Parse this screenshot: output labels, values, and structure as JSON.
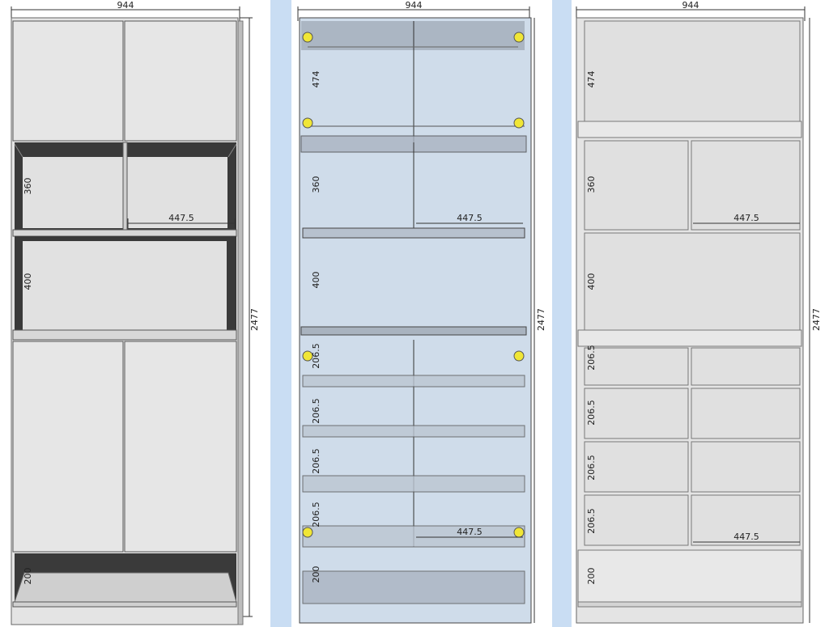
{
  "views": [
    {
      "id": "front-closed",
      "width_label": "944",
      "height_label": "2477",
      "dimensions": [
        {
          "key": "d1",
          "text": "360"
        },
        {
          "key": "d2",
          "text": "400"
        },
        {
          "key": "d3",
          "text": "200"
        },
        {
          "key": "d4",
          "text": "447.5"
        }
      ]
    },
    {
      "id": "transparent",
      "width_label": "944",
      "height_label": "2477",
      "dimensions": [
        {
          "key": "d1",
          "text": "474"
        },
        {
          "key": "d2",
          "text": "360"
        },
        {
          "key": "d3",
          "text": "400"
        },
        {
          "key": "d4",
          "text": "206.5"
        },
        {
          "key": "d5",
          "text": "206.5"
        },
        {
          "key": "d6",
          "text": "206.5"
        },
        {
          "key": "d7",
          "text": "206.5"
        },
        {
          "key": "d8",
          "text": "200"
        },
        {
          "key": "d9",
          "text": "447.5"
        },
        {
          "key": "d10",
          "text": "447.5"
        }
      ]
    },
    {
      "id": "open-front",
      "width_label": "944",
      "height_label": "2477",
      "dimensions": [
        {
          "key": "d1",
          "text": "474"
        },
        {
          "key": "d2",
          "text": "360"
        },
        {
          "key": "d3",
          "text": "400"
        },
        {
          "key": "d4",
          "text": "206.5"
        },
        {
          "key": "d5",
          "text": "206.5"
        },
        {
          "key": "d6",
          "text": "206.5"
        },
        {
          "key": "d7",
          "text": "206.5"
        },
        {
          "key": "d8",
          "text": "200"
        },
        {
          "key": "d9",
          "text": "447.5"
        },
        {
          "key": "d10",
          "text": "447.5"
        }
      ]
    }
  ],
  "colors": {
    "background": "#c9ddf3",
    "board": "#e4e4e4",
    "shadow": "#3a3a3a",
    "glass": "#cfdcea",
    "hinge": "#f0e636"
  }
}
